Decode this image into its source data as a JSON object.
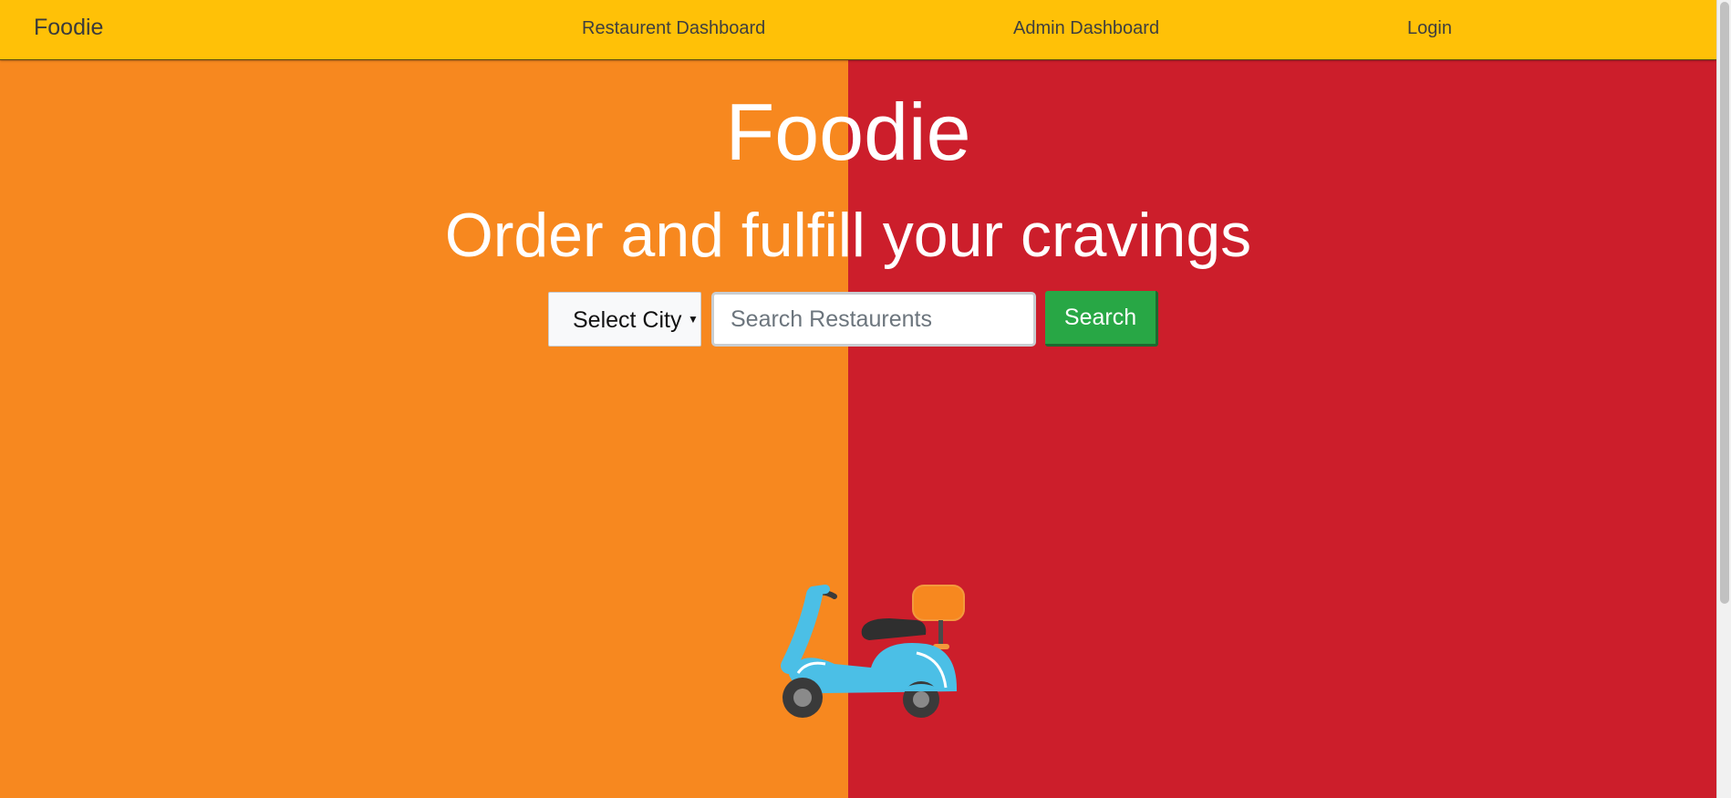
{
  "navbar": {
    "brand": "Foodie",
    "links": [
      {
        "label": "Restaurent Dashboard"
      },
      {
        "label": "Admin Dashboard"
      },
      {
        "label": "Login"
      }
    ]
  },
  "hero": {
    "title": "Foodie",
    "subtitle": "Order and fulfill your cravings"
  },
  "search": {
    "city_select": {
      "selected": "Select City",
      "icon": "caret-down-icon"
    },
    "input": {
      "value": "",
      "placeholder": "Search Restaurents"
    },
    "button_label": "Search"
  },
  "illustration": {
    "icon": "scooter-icon"
  },
  "colors": {
    "navbar": "#ffc107",
    "left_panel": "#f7881f",
    "right_panel": "#cc1e2b",
    "search_button": "#28a745",
    "scooter_body": "#4bbfe6",
    "scooter_box": "#f7881f"
  }
}
